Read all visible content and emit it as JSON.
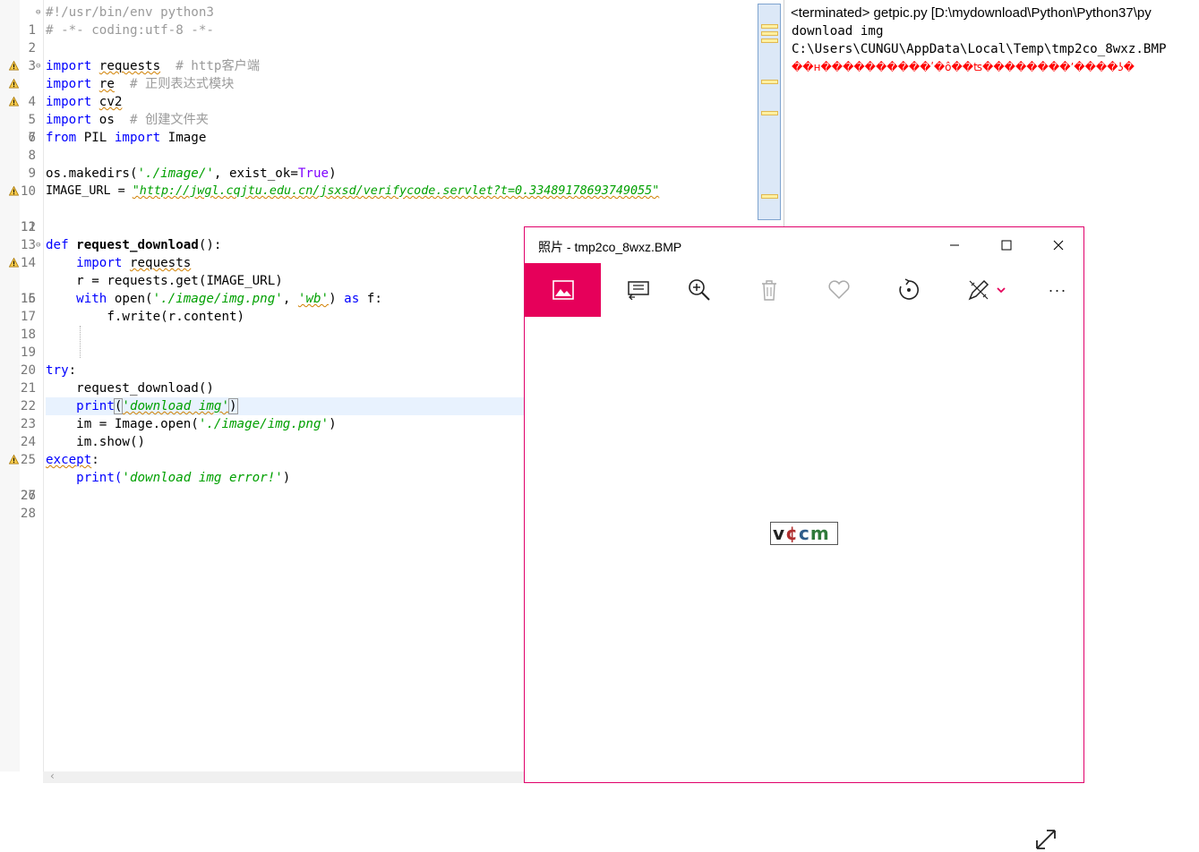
{
  "editor": {
    "lines": [
      {
        "n": "1"
      },
      {
        "n": "2"
      },
      {
        "n": "3"
      },
      {
        "n": "4"
      },
      {
        "n": "5"
      },
      {
        "n": "6"
      },
      {
        "n": "7"
      },
      {
        "n": "8"
      },
      {
        "n": "9"
      },
      {
        "n": "10"
      },
      {
        "n": "11"
      },
      {
        "n": "12"
      },
      {
        "n": "13"
      },
      {
        "n": "14"
      },
      {
        "n": "15"
      },
      {
        "n": "16"
      },
      {
        "n": "17"
      },
      {
        "n": "18"
      },
      {
        "n": "19"
      },
      {
        "n": "20"
      },
      {
        "n": "21"
      },
      {
        "n": "22"
      },
      {
        "n": "23"
      },
      {
        "n": "24"
      },
      {
        "n": "25"
      },
      {
        "n": "26"
      },
      {
        "n": "27"
      },
      {
        "n": "28"
      }
    ],
    "t": {
      "l1": "#!/usr/bin/env python3",
      "l2": "# -*- coding:utf-8 -*-",
      "l4a": "import",
      "l4b": "requests",
      "l4c": "  # http客户端",
      "l5a": "import",
      "l5b": "re",
      "l5c": "  # 正则表达式模块",
      "l6a": "import",
      "l6b": "cv2",
      "l7a": "import",
      "l7b": " os",
      "l7c": "  # 创建文件夹",
      "l8a": "from",
      "l8b": " PIL ",
      "l8c": "import",
      "l8d": " Image",
      "l10a": "os.makedirs(",
      "l10b": "'./image/'",
      "l10c": ", exist_ok=",
      "l10d": "True",
      "l10e": ")",
      "l11a": "IMAGE_URL = ",
      "l11b": "\"http://jwgl.cqjtu.edu.cn/jsxsd/verifycode.servlet?t=0.33489178693749055\"",
      "l14a": "def",
      "l14b": " request_download",
      "l14c": "():",
      "l15a": "    import",
      "l15b": "requests",
      "l16": "    r = requests.get(IMAGE_URL)",
      "l17a": "    with",
      "l17b": " open(",
      "l17c": "'./image/img.png'",
      "l17d": ", ",
      "l17e": "'wb'",
      "l17f": ") ",
      "l17g": "as",
      "l17h": " f:",
      "l18": "        f.write(r.content)",
      "l21a": "try",
      "l21b": ":",
      "l22": "    request_download()",
      "l23a": "    print",
      "l23b": "(",
      "l23c": "'download img'",
      "l23d": ")",
      "l24a": "    im = Image.open(",
      "l24b": "'./image/img.png'",
      "l24c": ")",
      "l25": "    im.show()",
      "l26a": "except",
      "l26b": ":",
      "l27a": "    print(",
      "l27b": "'download img error!'",
      "l27c": ")"
    }
  },
  "console": {
    "title": "<terminated> getpic.py [D:\\mydownload\\Python\\Python37\\py",
    "lines": [
      "download img",
      "C:\\Users\\CUNGU\\AppData\\Local\\Temp\\tmp2co_8wxz.BMP"
    ],
    "error_line": "��ʜ����������ʹ�ô��ʦ��������ʼ����ʖ�"
  },
  "photos": {
    "title": "照片 - tmp2co_8wxz.BMP",
    "toolbar": [
      "image-icon",
      "slideshow-icon",
      "zoom-in-icon",
      "delete-icon",
      "favorite-icon",
      "rotate-icon",
      "edit-icon",
      "more-icon"
    ],
    "more_label": "···",
    "captcha": [
      "v",
      "¢",
      "c",
      "m"
    ],
    "accent": "#e6005a"
  }
}
